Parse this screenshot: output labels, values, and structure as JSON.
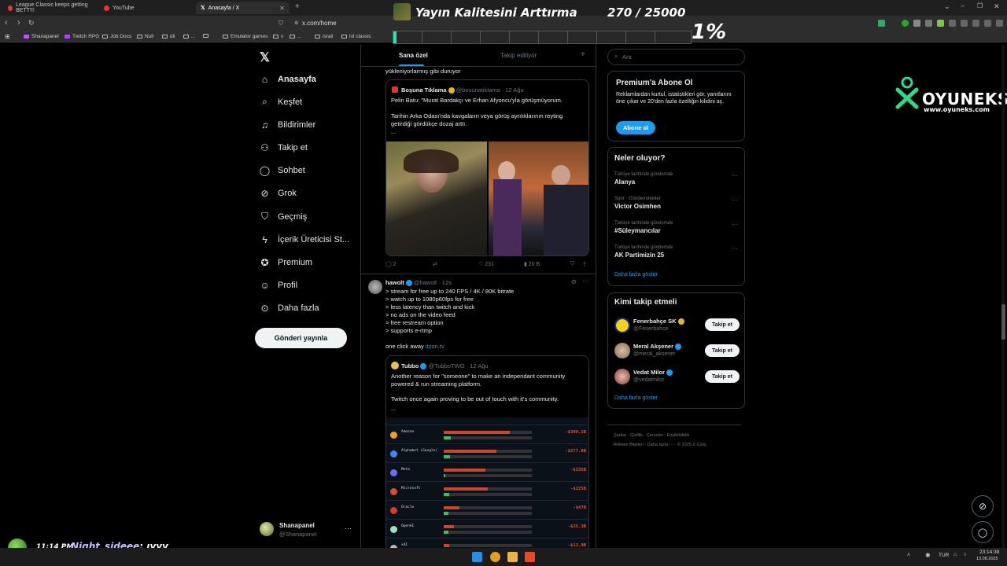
{
  "browser": {
    "tabs": [
      {
        "label": "League Classic keeps getting BETT!!!"
      },
      {
        "label": "YouTube"
      },
      {
        "label": "Anasayfa / X"
      }
    ],
    "url": "x.com/home",
    "bookmarks": [
      "Shanapanel",
      "Twitch RPG",
      "Job Docs",
      "Null",
      "dil",
      "...",
      "",
      "Emulator games",
      "x",
      "...",
      "israil",
      "lol classic"
    ]
  },
  "overlay": {
    "title": "Yayın Kalitesini Arttırma",
    "counter": "270 / 25000",
    "progress_fraction": 0.011,
    "progress_label": "1%",
    "brand": "OYUNEKS",
    "brand_url": "www.oyuneks.com",
    "clock": "11:14 PM",
    "chat_user": "Night_sideee",
    "chat_msg": ": ıyyy"
  },
  "nav": {
    "items": [
      {
        "label": "Anasayfa",
        "icon": "home-icon"
      },
      {
        "label": "Keşfet",
        "icon": "search-icon"
      },
      {
        "label": "Bildirimler",
        "icon": "bell-icon"
      },
      {
        "label": "Takip et",
        "icon": "add-user-icon"
      },
      {
        "label": "Sohbet",
        "icon": "chat-icon"
      },
      {
        "label": "Grok",
        "icon": "grok-icon"
      },
      {
        "label": "Geçmiş",
        "icon": "bookmark-icon"
      },
      {
        "label": "İçerik Üreticisi St...",
        "icon": "lightning-icon"
      },
      {
        "label": "Premium",
        "icon": "premium-icon"
      },
      {
        "label": "Profil",
        "icon": "person-icon"
      },
      {
        "label": "Daha fazla",
        "icon": "more-circle-icon"
      }
    ],
    "post_button": "Gönderi yayınla",
    "account": {
      "name": "Shanapanel",
      "handle": "@Shanapanel"
    }
  },
  "feed": {
    "tabs": [
      "Sana özel",
      "Takip ediliyor"
    ],
    "partial_text": "yükleniyorlarmış gibi duruyor",
    "quote1": {
      "name": "Boşuna Tıklama",
      "handle": "@bosunatiklama · 12 Ağu",
      "line1": "Pelin Batu: \"Murat Bardakçı ve Erhan Afyoncu'yla görüşmüyorum.",
      "line2": "Tarihin Arka Odası'nda kavgaların veya görüş ayrılıklarının reyting getirdiği gördükçe dozaj arttı.",
      "line3": "..."
    },
    "actions1": {
      "reply": "2",
      "like": "231",
      "views": "20 B"
    },
    "post2": {
      "name": "hawolt",
      "handle": "@hawolt · 12s",
      "lines": [
        "> stream for free up to 240 FPS / 4K / 80K bitrate",
        "> watch up to 1080p60fps for free",
        "> less latency than twitch and kick",
        "> no ads on the video feed",
        "> free restream option",
        "> supports e-rtmp"
      ],
      "click_text": "one click away",
      "click_link": "itzon.tv"
    },
    "quote2": {
      "name": "Tubbo",
      "handle": "@TubboTWO · 12 Ağu",
      "line1": "Another reason for \"someone\" to make an independant community powered & run streaming platform.",
      "line2": "Twitch once again proving to be out of touch with it's community.",
      "line3": "..."
    },
    "table_rows": [
      {
        "name": "Amazon",
        "value": "-$300.1B",
        "red": 0.75,
        "green": 0.08,
        "color": "#f29e1f"
      },
      {
        "name": "Alphabet (Google)",
        "value": "-$277.0B",
        "red": 0.6,
        "green": 0.07,
        "color": "#4285f4"
      },
      {
        "name": "Meta",
        "value": "-$235B",
        "red": 0.47,
        "green": 0.02,
        "color": "#6d6dff"
      },
      {
        "name": "Microsoft",
        "value": "-$225B",
        "red": 0.5,
        "green": 0.06,
        "color": "#e04a2a"
      },
      {
        "name": "Oracle",
        "value": "-$47B",
        "red": 0.18,
        "green": 0.05,
        "color": "#d73b2b"
      },
      {
        "name": "OpenAI",
        "value": "-$35.3B",
        "red": 0.12,
        "green": 0.05,
        "color": "#9edfc2"
      },
      {
        "name": "xAI",
        "value": "-$12.9B",
        "red": 0.06,
        "green": 0.03,
        "color": "#bbbbbb"
      }
    ]
  },
  "sidebar": {
    "search_placeholder": "Ara",
    "premium": {
      "title": "Premium'a Abone Ol",
      "text": "Reklamlardan kurtul, istatistikleri gör, yanıtlarını öne çıkar ve 20'den fazla özelliğin kilidini aç.",
      "button": "Abone ol"
    },
    "trends_title": "Neler oluyor?",
    "trends": [
      {
        "category": "Türkiye tarihinde gündemde",
        "name": "Alanya"
      },
      {
        "category": "Spor · Gündemdekiler",
        "name": "Victor Osimhen"
      },
      {
        "category": "Türkiye tarihinde gündemde",
        "name": "#Süleymancılar"
      },
      {
        "category": "Türkiye tarihinde gündemde",
        "name": "AK Partimizin 25"
      }
    ],
    "trends_more": "Daha fazla göster",
    "who_title": "Kimi takip etmeli",
    "who": [
      {
        "name": "Fenerbahçe SK",
        "handle": "@Fenerbahce",
        "button": "Takip et"
      },
      {
        "name": "Meral Akşener",
        "handle": "@meral_aksener",
        "button": "Takip et"
      },
      {
        "name": "Vedat Milor",
        "handle": "@vedatmilor",
        "button": "Takip et"
      }
    ],
    "who_more": "Daha fazla göster",
    "footer1": "Şartlar  ·  Gizlilik  ·  Çerezler  ·  Erişilebilirlik",
    "footer2": "Reklam Bilgileri  ·  Daha fazla ···  ·  © 2025 X Corp."
  },
  "taskbar": {
    "lang": "TUR",
    "time": "23:14:39",
    "date": "13.08.2025"
  }
}
